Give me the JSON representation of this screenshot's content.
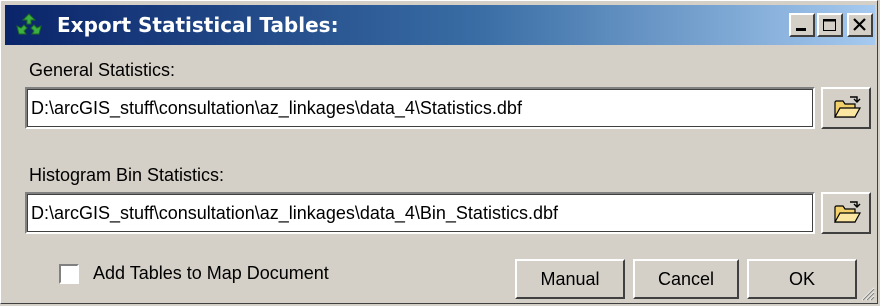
{
  "window": {
    "title": "Export Statistical Tables:",
    "controls": {
      "minimize": "minimize",
      "maximize": "maximize",
      "close": "close"
    }
  },
  "general": {
    "label": "General Statistics:",
    "value": "D:\\arcGIS_stuff\\consultation\\az_linkages\\data_4\\Statistics.dbf",
    "browse_icon": "open-folder-icon"
  },
  "histogram": {
    "label": "Histogram Bin Statistics:",
    "value": "D:\\arcGIS_stuff\\consultation\\az_linkages\\data_4\\Bin_Statistics.dbf",
    "browse_icon": "open-folder-icon"
  },
  "options": {
    "add_tables_label": "Add Tables to Map Document",
    "add_tables_checked": false
  },
  "buttons": {
    "manual": "Manual",
    "cancel": "Cancel",
    "ok": "OK"
  },
  "colors": {
    "title_start": "#0a246a",
    "title_end": "#a6caf0",
    "face": "#d4d0c8"
  }
}
